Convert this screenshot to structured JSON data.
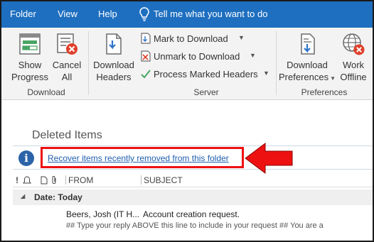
{
  "menu": {
    "items": [
      "Folder",
      "View",
      "Help"
    ],
    "tell_me": "Tell me what you want to do"
  },
  "ribbon": {
    "download_group": {
      "label": "Download",
      "show_progress": [
        "Show",
        "Progress"
      ],
      "cancel_all": [
        "Cancel",
        "All"
      ],
      "download_headers": [
        "Download",
        "Headers"
      ]
    },
    "server_group": {
      "label": "Server",
      "mark_to_download": "Mark to Download",
      "unmark_to_download": "Unmark to Download",
      "process_marked_headers": "Process Marked Headers"
    },
    "preferences_group": {
      "label": "Preferences",
      "download_preferences": [
        "Download",
        "Preferences"
      ],
      "work_offline": [
        "Work",
        "Offline"
      ]
    }
  },
  "folder": {
    "title": "Deleted Items",
    "recover_link": "Recover items recently removed from this folder"
  },
  "columns": {
    "from": "FROM",
    "subject": "SUBJECT"
  },
  "group_header": "Date: Today",
  "messages": [
    {
      "from": "Beers, Josh (IT H...",
      "subject": "Account creation request.",
      "preview": "## Type your reply ABOVE this line to include in your request ##  You are a"
    }
  ],
  "colors": {
    "menubar": "#1e6fc0",
    "highlight": "#e11111",
    "link": "#1e5fae"
  }
}
